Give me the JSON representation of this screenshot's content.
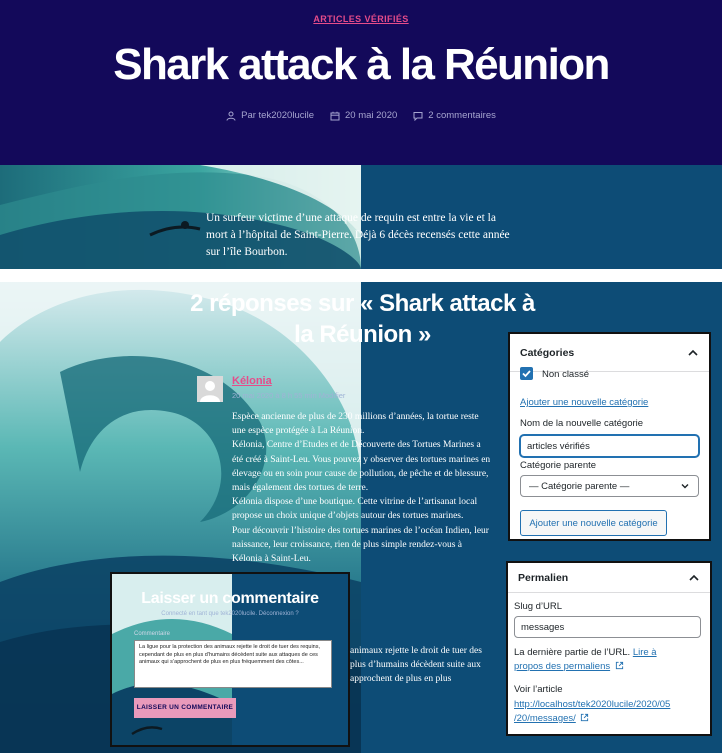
{
  "post": {
    "category": "ARTICLES VÉRIFIÉS",
    "title": "Shark attack à la Réunion",
    "author": "Par tek2020lucile",
    "date": "20 mai 2020",
    "comments": "2 commentaires"
  },
  "hero": {
    "caption": "Un surfeur victime d’une attaque de requin est entre la vie et la mort à l’hôpital de Saint-Pierre. Déjà 6 décès recensés cette année sur l’île Bourbon."
  },
  "comments_section": {
    "title_line1": "2 réponses sur « Shark attack à",
    "title_line2": "la Réunion »",
    "comment": {
      "author": "Kélonia",
      "date": "20 mai 2020 à 8 h 55 min",
      "edit": "Modifier",
      "p1": "Espèce ancienne de plus de 230 millions d’années, la tortue reste une espèce protégée à La Réunion.",
      "p2": "Kélonia, Centre d’Etudes et de Découverte des Tortues Marines a été créé à Saint-Leu. Vous pouvez y observer des tortues marines en élevage ou en soin pour cause de pollution, de pêche et de blessure, mais également des tortues de terre.",
      "p3": "Kélonia dispose d’une boutique. Cette vitrine de l’artisanat local propose un choix unique d’objets autour des tortues marines.",
      "p4": "Pour découvrir l’histoire des tortues marines de l’océan Indien, leur naissance, leur croissance, rien de plus simple rendez-vous à Kélonia à Saint-Leu."
    },
    "fragment": {
      "l1": "animaux rejette le droit de tuer des",
      "l2": "plus d’humains décèdent suite aux",
      "l3": "approchent de plus en plus"
    }
  },
  "comment_form": {
    "title": "Laisser un commentaire",
    "logged_in": "Connecté en tant que tek2020lucile. Déconnexion ?",
    "label": "Commentaire",
    "text": "La ligue pour la protection des animaux rejette le droit de tuer des requins, cependant de plus en plus d’humains décèdent suite aux attaques de ces animaux qui s’approchent de plus en plus fréquemment des côtes...",
    "submit": "LAISSER UN COMMENTAIRE"
  },
  "categories_panel": {
    "title": "Catégories",
    "checkbox_label": "Non classé",
    "add_link": "Ajouter une nouvelle catégorie",
    "name_label": "Nom de la nouvelle catégorie",
    "name_value": "articles vérifiés",
    "parent_label": "Catégorie parente",
    "parent_value": "— Catégorie parente —",
    "add_button": "Ajouter une nouvelle catégorie"
  },
  "permalink_panel": {
    "title": "Permalien",
    "slug_label": "Slug d’URL",
    "slug_value": "messages",
    "help_text": "La dernière partie de l’URL.",
    "help_link_1": "Lire à",
    "help_link_2": "propos des permaliens",
    "view_label": "Voir l’article",
    "url_line1": "http://localhost/tek2020lucile/2020/05",
    "url_line2": "/20/messages/"
  },
  "colors": {
    "header_bg": "#13095a",
    "accent_pink": "#e64c8a",
    "ocean_blue": "#0d4c76",
    "wp_blue": "#2271b1"
  }
}
